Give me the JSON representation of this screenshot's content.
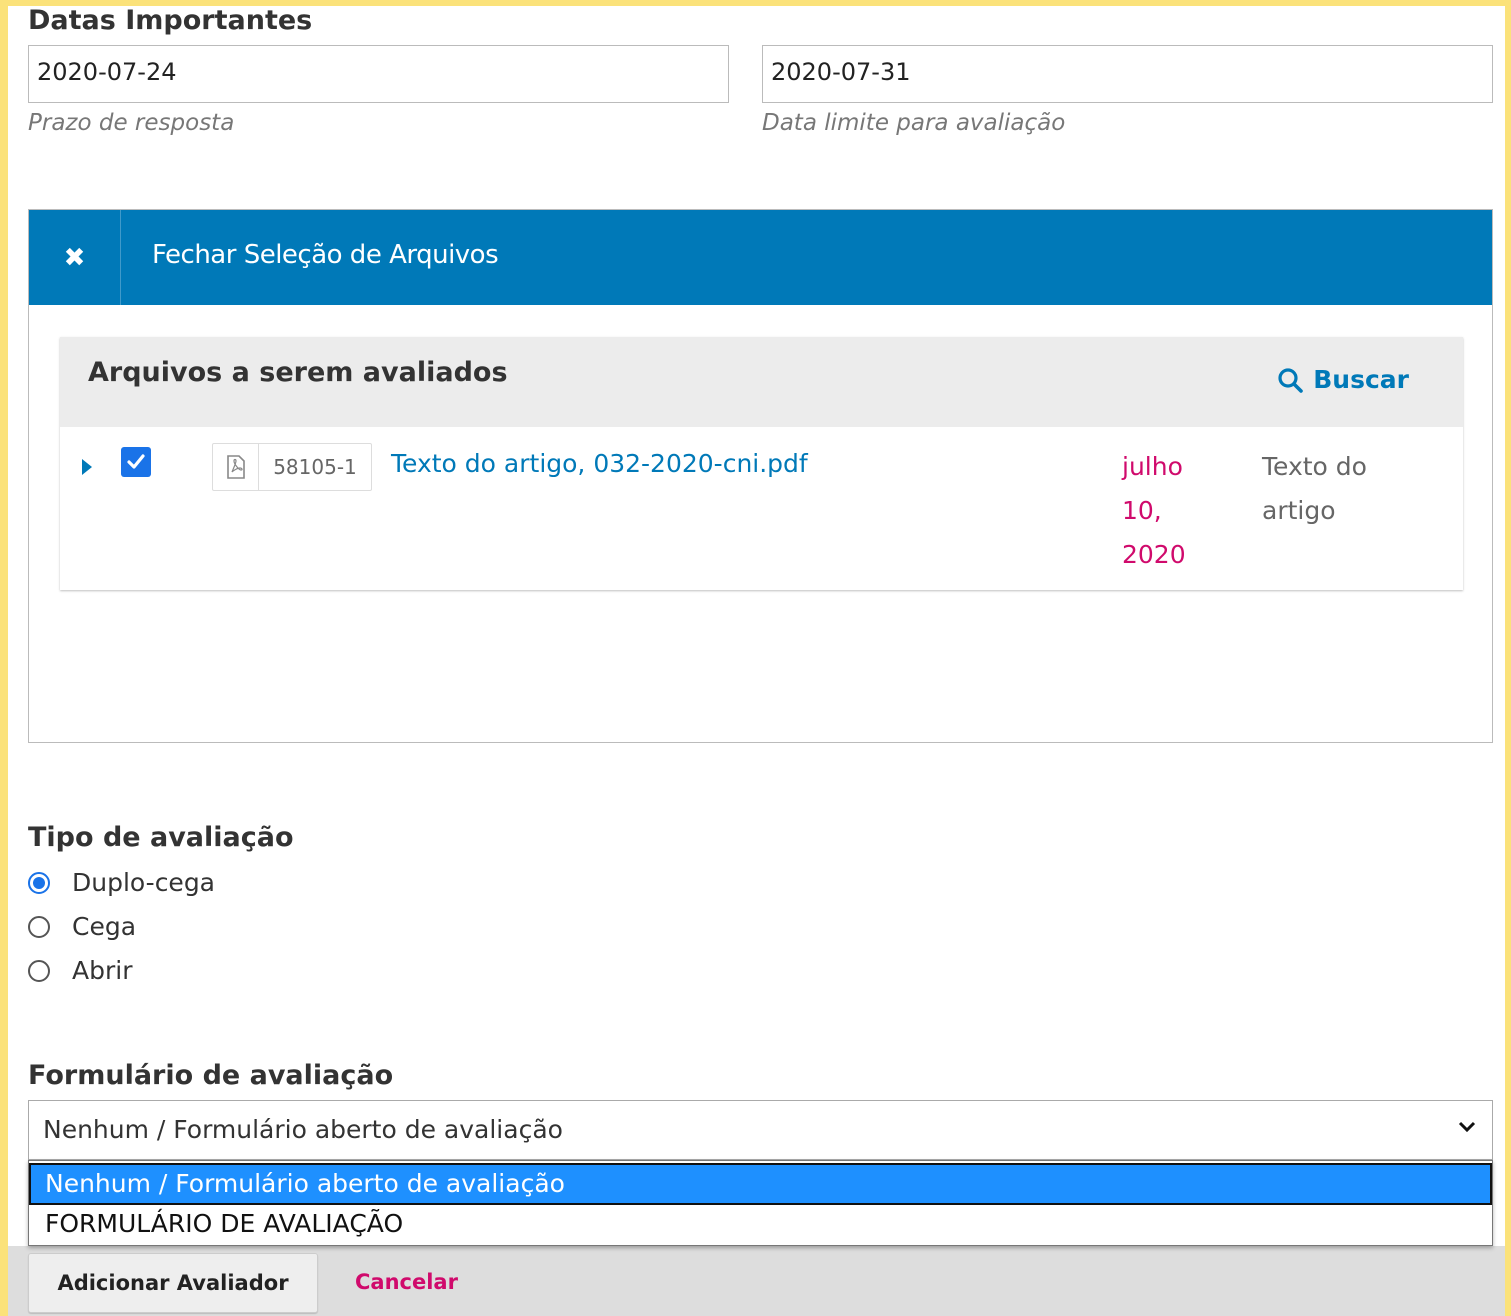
{
  "dates": {
    "section_title": "Datas Importantes",
    "response_due": {
      "value": "2020-07-24",
      "help": "Prazo de resposta"
    },
    "review_due": {
      "value": "2020-07-31",
      "help": "Data limite para avaliação"
    }
  },
  "files_panel": {
    "close_label": "Fechar Seleção de Arquivos",
    "close_icon": "close-icon",
    "grid_title": "Arquivos a serem avaliados",
    "search_label": "Buscar",
    "search_icon": "search-icon",
    "rows": [
      {
        "checked": true,
        "file_id": "58105-1",
        "file_name": "Texto do artigo, 032-2020-cni.pdf",
        "date_lines": [
          "julho",
          "10,",
          "2020"
        ],
        "type_lines": [
          "Texto do",
          "artigo"
        ]
      }
    ]
  },
  "review_type": {
    "title": "Tipo de avaliação",
    "options": [
      {
        "label": "Duplo-cega",
        "selected": true
      },
      {
        "label": "Cega",
        "selected": false
      },
      {
        "label": "Abrir",
        "selected": false
      }
    ]
  },
  "review_form": {
    "title": "Formulário de avaliação",
    "selected_value": "Nenhum / Formulário aberto de avaliação",
    "options": [
      "Nenhum / Formulário aberto de avaliação",
      "FORMULÁRIO DE AVALIAÇÃO"
    ]
  },
  "actions": {
    "add_reviewer": "Adicionar Avaliador",
    "cancel": "Cancelar"
  },
  "colors": {
    "accent": "#0079b8",
    "danger": "#d00a6c",
    "frame": "#fbe27a"
  }
}
